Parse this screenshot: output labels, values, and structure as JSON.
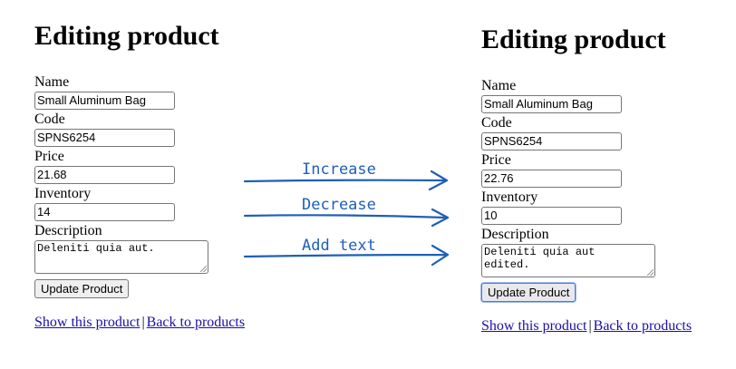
{
  "left": {
    "title": "Editing product",
    "fields": {
      "name_label": "Name",
      "name_value": "Small Aluminum Bag",
      "code_label": "Code",
      "code_value": "SPNS6254",
      "price_label": "Price",
      "price_value": "21.68",
      "inventory_label": "Inventory",
      "inventory_value": "14",
      "description_label": "Description",
      "description_value": "Deleniti quia aut."
    },
    "submit_label": "Update Product",
    "links": {
      "show": "Show this product",
      "separator": "|",
      "back": "Back to products"
    }
  },
  "right": {
    "title": "Editing product",
    "fields": {
      "name_label": "Name",
      "name_value": "Small Aluminum Bag",
      "code_label": "Code",
      "code_value": "SPNS6254",
      "price_label": "Price",
      "price_value": "22.76",
      "inventory_label": "Inventory",
      "inventory_value": "10",
      "description_label": "Description",
      "description_value": "Deleniti quia aut\nedited."
    },
    "submit_label": "Update Product",
    "links": {
      "show": "Show this product",
      "separator": "|",
      "back": "Back to products"
    }
  },
  "annotations": {
    "increase": "Increase",
    "decrease": "Decrease",
    "add_text": "Add text",
    "arrow_color": "#1f5fb8"
  }
}
